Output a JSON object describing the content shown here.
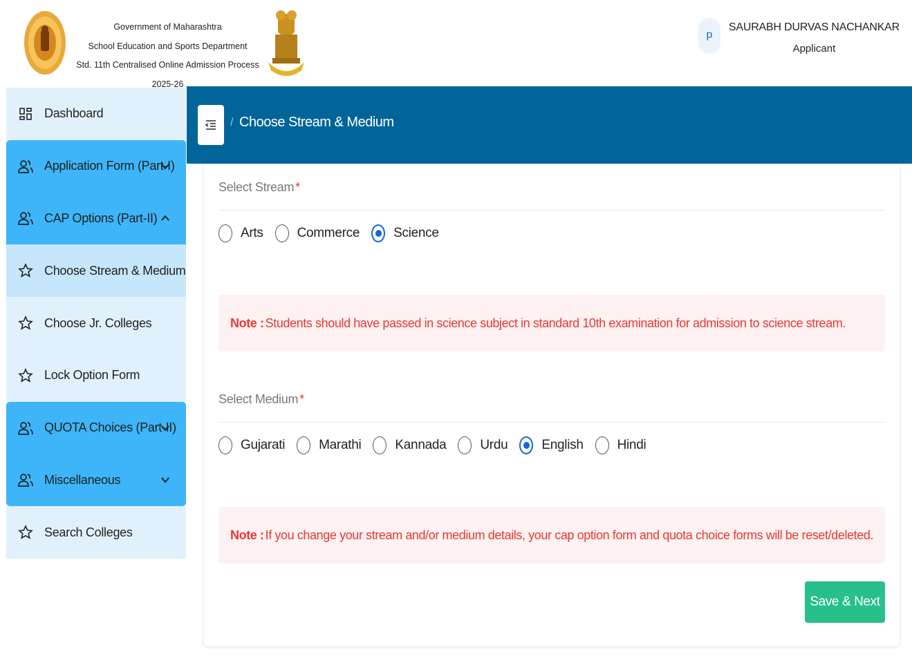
{
  "header": {
    "line1": "Government of Maharashtra",
    "line2": "School Education and Sports Department",
    "line3": "Std. 11th Centralised Online Admission Process 2025-26",
    "logo_left_icon": "maharashtra-seal-icon",
    "emblem_icon": "state-emblem-icon"
  },
  "user": {
    "avatar_letter": "p",
    "name": "SAURABH DURVAS NACHANKAR",
    "role": "Applicant"
  },
  "sidebar": {
    "items": [
      {
        "label": "Dashboard",
        "icon": "dashboard-icon"
      },
      {
        "label": "Application Form (Part-I)",
        "icon": "users-icon",
        "chevron": "down"
      },
      {
        "label": "CAP Options (Part-II)",
        "icon": "users-icon",
        "chevron": "up"
      },
      {
        "label": "Choose Stream & Medium",
        "icon": "star-icon",
        "active": true
      },
      {
        "label": "Choose Jr. Colleges",
        "icon": "star-icon"
      },
      {
        "label": "Lock Option Form",
        "icon": "star-icon"
      },
      {
        "label": "QUOTA Choices (Part-II)",
        "icon": "users-icon",
        "chevron": "down"
      },
      {
        "label": "Miscellaneous",
        "icon": "users-icon",
        "chevron": "down"
      },
      {
        "label": "Search Colleges",
        "icon": "star-icon"
      }
    ]
  },
  "topbar": {
    "separator": "/",
    "breadcrumb": "Choose Stream & Medium"
  },
  "stream": {
    "label": "Select Stream",
    "required_mark": "*",
    "options": [
      "Arts",
      "Commerce",
      "Science"
    ],
    "selected": "Science"
  },
  "note1": {
    "prefix": "Note :",
    "text": "Students should have passed in science subject in standard 10th examination for admission to science stream."
  },
  "medium": {
    "label": "Select Medium",
    "required_mark": "*",
    "options": [
      "Gujarati",
      "Marathi",
      "Kannada",
      "Urdu",
      "English",
      "Hindi"
    ],
    "selected": "English"
  },
  "note2": {
    "prefix": "Note : ",
    "text": "If you change your stream and/or medium details, your cap option form and quota choice forms will be reset/deleted."
  },
  "save_button": "Save & Next",
  "colors": {
    "topbar": "#02659a",
    "sidebar_blue": "#3db5f8",
    "sidebar_light": "#e1f1fb",
    "sidebar_active": "#c5e6fb",
    "save_button": "#27bf8a",
    "note_text": "#e53935",
    "radio_selected": "#1565d8"
  }
}
